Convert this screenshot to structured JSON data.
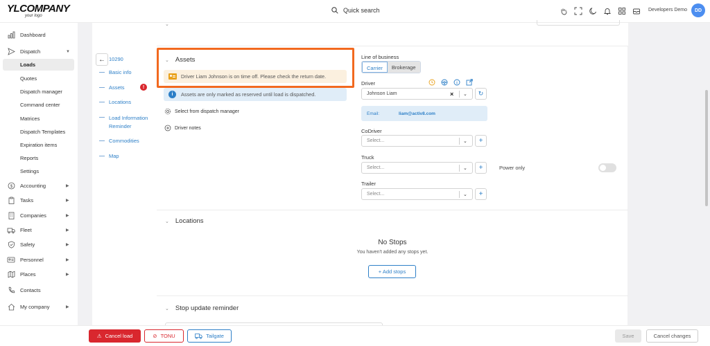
{
  "header": {
    "logo_main": "YLCOMPANY",
    "logo_sub": "your logo",
    "quick_search": "Quick search",
    "user_name": "Developers Demo",
    "user_initials": "DD"
  },
  "sidebar": {
    "dashboard": "Dashboard",
    "dispatch": "Dispatch",
    "dispatch_items": [
      "Loads",
      "Quotes",
      "Dispatch manager",
      "Command center",
      "Matrices",
      "Dispatch Templates",
      "Expiration items",
      "Reports",
      "Settings"
    ],
    "groups": [
      "Accounting",
      "Tasks",
      "Companies",
      "Fleet",
      "Safety",
      "Personnel",
      "Places",
      "Contacts",
      "My company"
    ]
  },
  "anchors": {
    "load_id": "10290",
    "items": [
      "Basic info",
      "Assets",
      "Locations",
      "Load Information Reminder",
      "Commodities",
      "Map"
    ],
    "assets_badge": "!"
  },
  "assets": {
    "title": "Assets",
    "time_off_alert": "Driver Liam Johnson is on time off. Please check the return date.",
    "info_alert": "Assets are only marked as reserved until load is dispatched.",
    "select_from_dm": "Select from dispatch manager",
    "driver_notes": "Driver notes",
    "line_of_business_label": "Line of business",
    "lob_options": [
      "Carrier",
      "Brokerage"
    ],
    "lob_selected": "Carrier",
    "driver_label": "Driver",
    "driver_value": "Johnson Liam",
    "email_label": "Email:",
    "email_value": "liam@activ8.com",
    "codriver_label": "CoDriver",
    "truck_label": "Truck",
    "trailer_label": "Trailer",
    "select_placeholder": "Select...",
    "power_only_label": "Power only",
    "power_only_on": false
  },
  "locations": {
    "title": "Locations",
    "empty_title": "No Stops",
    "empty_text": "You haven't added any stops yet.",
    "add_button": "+ Add stops"
  },
  "stop_update": {
    "title": "Stop update reminder"
  },
  "footer": {
    "cancel_load": "Cancel load",
    "tonu": "TONU",
    "tailgate": "Tailgate",
    "save": "Save",
    "cancel_changes": "Cancel changes"
  },
  "colors": {
    "accent": "#2d7fc7",
    "danger": "#d9272e",
    "highlight": "#f2691f"
  }
}
